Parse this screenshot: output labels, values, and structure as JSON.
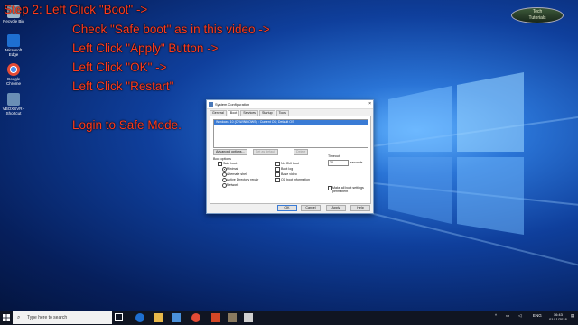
{
  "overlay": {
    "lines": [
      {
        "prefix": "Step 2: Left Click ",
        "quoted": "Boot",
        "suffix": " ->"
      },
      {
        "prefix": "Check ",
        "quoted": "Safe boot",
        "suffix": " as in this video ->"
      },
      {
        "prefix": "Left Click ",
        "quoted": "Apply",
        "suffix": " Button ->"
      },
      {
        "prefix": "Left Click ",
        "quoted": "OK",
        "suffix": " ->"
      },
      {
        "prefix": "Left Click ",
        "quoted": "Restart",
        "suffix": ""
      }
    ],
    "final": "Login to Safe Mode."
  },
  "badge": {
    "line1": "Tech",
    "line2": "Tutorials"
  },
  "desktop_icons": [
    {
      "label": "Recycle Bin",
      "icon": "recycle-bin-icon",
      "color": "#9fb7c9"
    },
    {
      "label": "Microsoft Edge",
      "icon": "edge-icon",
      "color": "#1e6fd0"
    },
    {
      "label": "Google Chrome",
      "icon": "chrome-icon",
      "color": "#e44b35"
    },
    {
      "label": "VBOXSVR - Shortcut",
      "icon": "network-drive-icon",
      "color": "#6a8fb5"
    }
  ],
  "dialog": {
    "title": "System Configuration",
    "close": "×",
    "tabs": [
      "General",
      "Boot",
      "Services",
      "Startup",
      "Tools"
    ],
    "active_tab": "Boot",
    "os_entry": "Windows 10 (C:\\WINDOWS) : Current OS; Default OS",
    "buttons_row": [
      "Advanced options...",
      "Set as default",
      "Delete"
    ],
    "boot_options_label": "Boot options",
    "safe_boot": "Safe boot",
    "safe_boot_checked": true,
    "radio_options": [
      "Minimal",
      "Alternate shell",
      "Active Directory repair",
      "Network"
    ],
    "radio_selected": "Minimal",
    "right_options": [
      "No GUI boot",
      "Boot log",
      "Base video",
      "OS boot information"
    ],
    "timeout_label": "Timeout:",
    "timeout_value": "30",
    "timeout_unit": "seconds",
    "permanent_label": "Make all boot settings permanent",
    "footer_buttons": [
      "OK",
      "Cancel",
      "Apply",
      "Help"
    ]
  },
  "taskbar": {
    "search_placeholder": "Type here to search",
    "tray_lang": "ENG",
    "clock_time": "16:43",
    "clock_date": "01/11/2018"
  }
}
